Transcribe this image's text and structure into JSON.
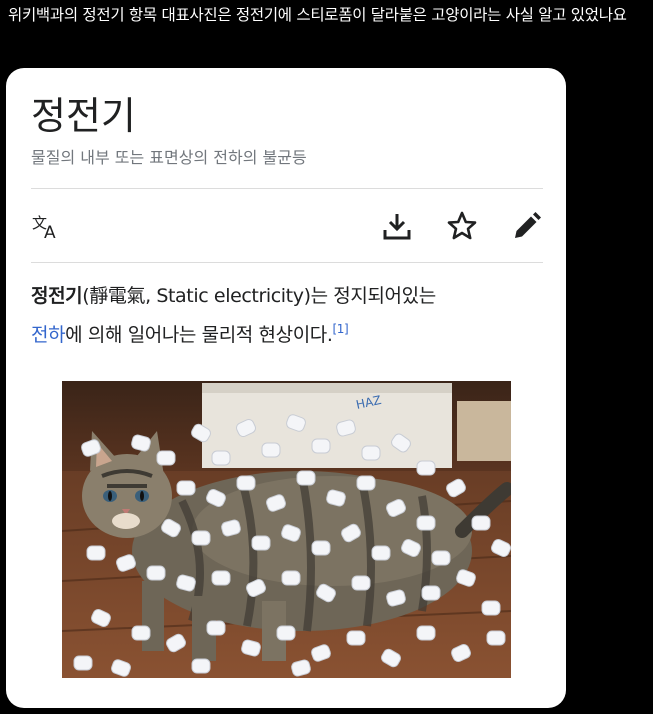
{
  "post": {
    "text": "위키백과의 정전기 항목 대표사진은 정전기에 스티로폼이 달라붙은 고양이라는 사실 알고 있었나요"
  },
  "article": {
    "title": "정전기",
    "description": "물질의 내부 또는 표면상의 전하의 불균등",
    "toolbar": {
      "language_icon": "translate-icon",
      "download_icon": "download-icon",
      "bookmark_icon": "star-icon",
      "edit_icon": "pencil-icon"
    },
    "body": {
      "bold_term": "정전기",
      "paren_text": "(靜電氣, Static electricity)는 정지되어있는",
      "link_text": "전하",
      "rest_text": "에 의해 일어나는 물리적 현상이다.",
      "footnote": "[1]"
    },
    "image_alt": "cat-covered-in-styrofoam-peanuts"
  },
  "colors": {
    "background": "#000000",
    "card": "#ffffff",
    "link": "#3366cc",
    "text": "#202122",
    "muted": "#72777d"
  }
}
